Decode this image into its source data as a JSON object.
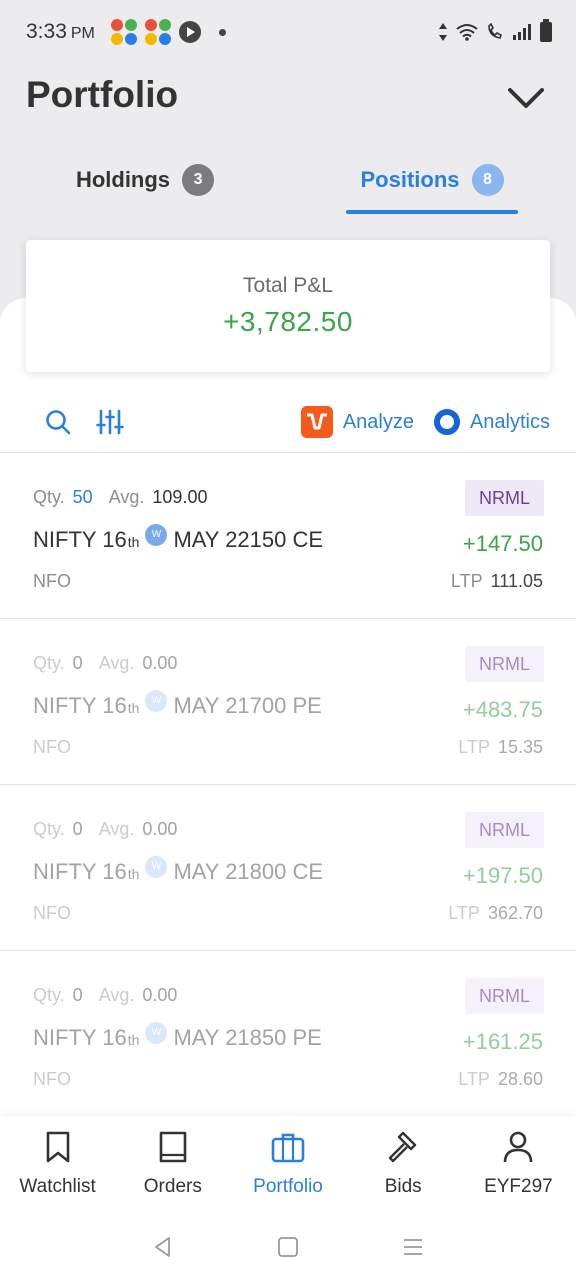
{
  "status_bar": {
    "time": "3:33",
    "ampm": "PM"
  },
  "header": {
    "title": "Portfolio"
  },
  "tabs": [
    {
      "label": "Holdings",
      "count": "3"
    },
    {
      "label": "Positions",
      "count": "8"
    }
  ],
  "summary": {
    "label": "Total P&L",
    "value": "+3,782.50"
  },
  "toolbar": {
    "analyze_label": "Analyze",
    "analytics_label": "Analytics"
  },
  "positions": [
    {
      "qty_label": "Qty.",
      "qty": "50",
      "avg_label": "Avg.",
      "avg": "109.00",
      "product": "NRML",
      "name_prefix": "NIFTY 16",
      "name_sup": "th",
      "weekly": "W",
      "name_suffix": "MAY 22150 CE",
      "pnl": "+147.50",
      "exchange": "NFO",
      "ltp_label": "LTP",
      "ltp": "111.05"
    },
    {
      "qty_label": "Qty.",
      "qty": "0",
      "avg_label": "Avg.",
      "avg": "0.00",
      "product": "NRML",
      "name_prefix": "NIFTY 16",
      "name_sup": "th",
      "weekly": "W",
      "name_suffix": "MAY 21700 PE",
      "pnl": "+483.75",
      "exchange": "NFO",
      "ltp_label": "LTP",
      "ltp": "15.35"
    },
    {
      "qty_label": "Qty.",
      "qty": "0",
      "avg_label": "Avg.",
      "avg": "0.00",
      "product": "NRML",
      "name_prefix": "NIFTY 16",
      "name_sup": "th",
      "weekly": "W",
      "name_suffix": "MAY 21800 CE",
      "pnl": "+197.50",
      "exchange": "NFO",
      "ltp_label": "LTP",
      "ltp": "362.70"
    },
    {
      "qty_label": "Qty.",
      "qty": "0",
      "avg_label": "Avg.",
      "avg": "0.00",
      "product": "NRML",
      "name_prefix": "NIFTY 16",
      "name_sup": "th",
      "weekly": "W",
      "name_suffix": "MAY 21850 PE",
      "pnl": "+161.25",
      "exchange": "NFO",
      "ltp_label": "LTP",
      "ltp": "28.60"
    }
  ],
  "bottom_nav": [
    {
      "label": "Watchlist",
      "icon": "bookmark-icon"
    },
    {
      "label": "Orders",
      "icon": "book-icon"
    },
    {
      "label": "Portfolio",
      "icon": "briefcase-icon"
    },
    {
      "label": "Bids",
      "icon": "gavel-icon"
    },
    {
      "label": "EYF297",
      "icon": "user-icon"
    }
  ],
  "colors": {
    "accent": "#2a7fde",
    "profit": "#3aa54a",
    "product_bg": "#efe8f7",
    "product_text": "#6a3f9e"
  }
}
